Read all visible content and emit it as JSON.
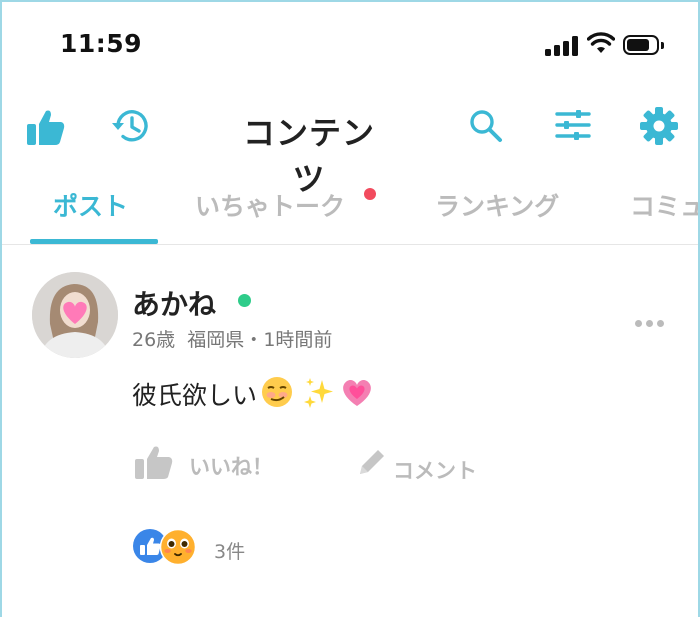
{
  "status_bar": {
    "time": "11:59"
  },
  "header": {
    "title": "コンテンツ",
    "icons": [
      "thumbs-up-icon",
      "history-icon",
      "search-icon",
      "filter-sliders-icon",
      "gear-icon"
    ]
  },
  "tabs": [
    {
      "label": "ポスト",
      "active": true
    },
    {
      "label": "いちゃトーク",
      "active": false,
      "has_badge": true
    },
    {
      "label": "ランキング",
      "active": false
    },
    {
      "label": "コミュ",
      "active": false
    }
  ],
  "post": {
    "username": "あかね",
    "online": true,
    "age": "26歳",
    "location": "福岡県",
    "separator": "・",
    "time_ago": "1時間前",
    "text": "彼氏欲しい",
    "emojis": [
      "smirking-face",
      "sparkles",
      "growing-heart"
    ],
    "actions": {
      "like": "いいね！",
      "comment": "コメント"
    },
    "reactions": {
      "count_label": "3件",
      "types": [
        "like",
        "blushing-face"
      ]
    }
  },
  "colors": {
    "accent": "#3bb8d4",
    "badge": "#f24b5e",
    "online": "#2ecc8a",
    "inactive": "#bbbbbb"
  }
}
